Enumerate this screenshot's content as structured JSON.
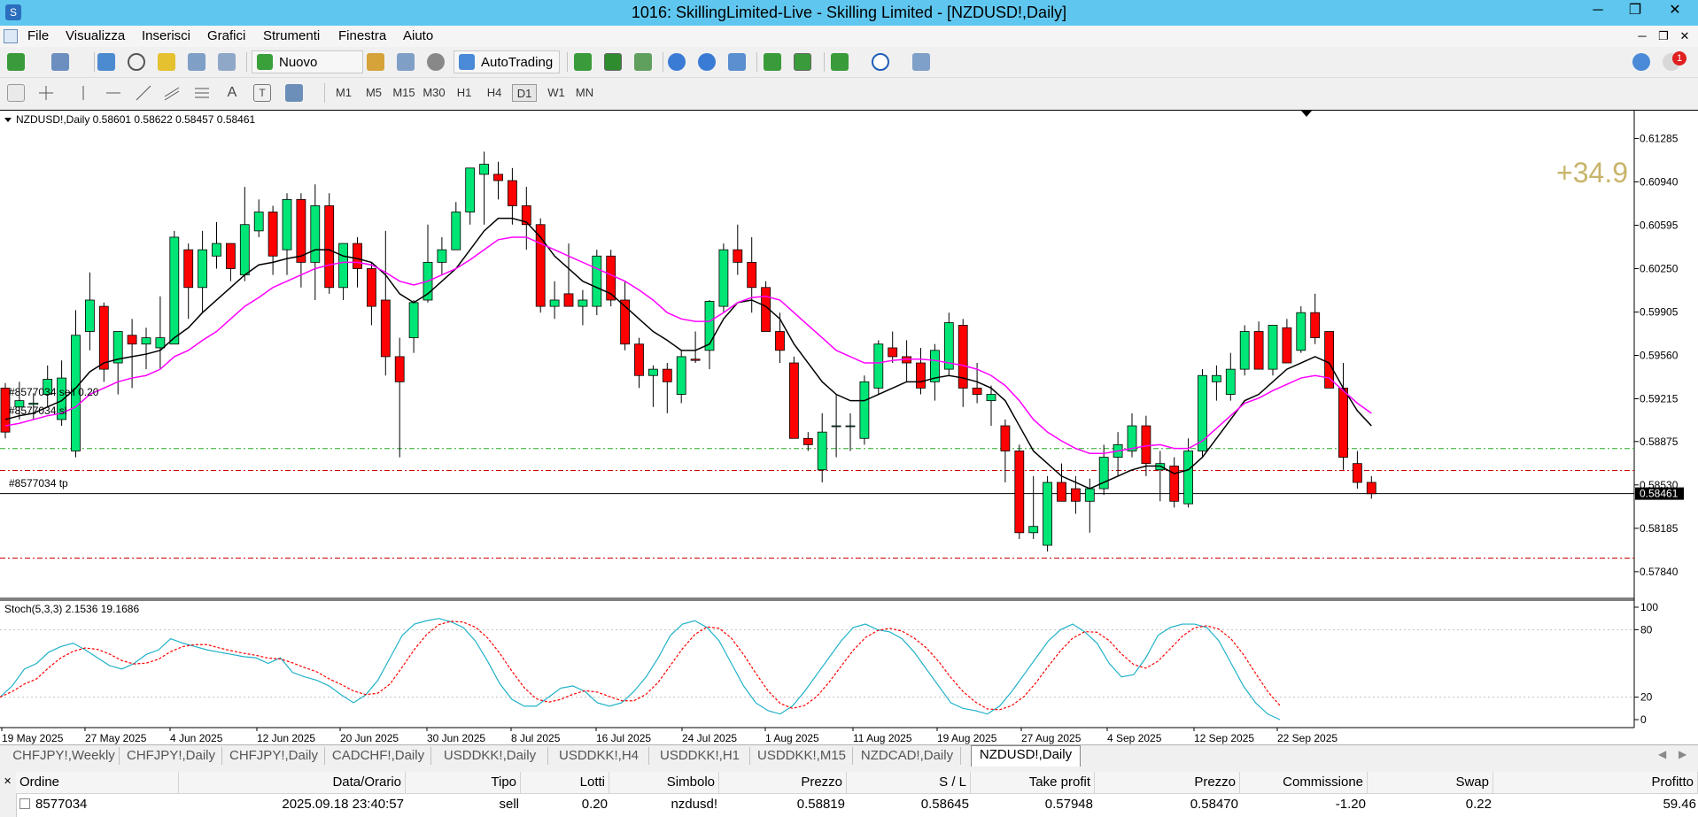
{
  "window": {
    "title": "1016: SkillingLimited-Live - Skilling Limited - [NZDUSD!,Daily]",
    "minimize": "─",
    "restore": "❐",
    "close": "✕"
  },
  "menu": [
    "File",
    "Visualizza",
    "Inserisci",
    "Grafici",
    "Strumenti",
    "Finestra",
    "Aiuto"
  ],
  "toolbar": {
    "new_order": "Nuovo ordine",
    "autotrading": "AutoTrading",
    "notification_count": "1"
  },
  "timeframes": [
    "M1",
    "M5",
    "M15",
    "M30",
    "H1",
    "H4",
    "D1",
    "W1",
    "MN"
  ],
  "active_timeframe": "D1",
  "chart": {
    "header": "NZDUSD!,Daily  0.58601 0.58622 0.58457 0.58461",
    "profit_overlay": "+34.9",
    "current_price": "0.58461",
    "price_ticks": [
      "0.61285",
      "0.60940",
      "0.60595",
      "0.60250",
      "0.59905",
      "0.59560",
      "0.59215",
      "0.58875",
      "0.58530",
      "0.58185",
      "0.57840"
    ],
    "line_labels": {
      "sell": "#8577034 sell 0.20",
      "sl": "#8577034 sl",
      "tp": "#8577034 tp"
    },
    "stoch_header": "Stoch(5,3,3) 2.1536 19.1686",
    "stoch_ticks": [
      "100",
      "80",
      "20",
      "0"
    ],
    "date_ticks": [
      "19 May 2025",
      "27 May 2025",
      "4 Jun 2025",
      "12 Jun 2025",
      "20 Jun 2025",
      "30 Jun 2025",
      "8 Jul 2025",
      "16 Jul 2025",
      "24 Jul 2025",
      "1 Aug 2025",
      "11 Aug 2025",
      "19 Aug 2025",
      "27 Aug 2025",
      "4 Sep 2025",
      "12 Sep 2025",
      "22 Sep 2025"
    ]
  },
  "chart_data": {
    "type": "candlestick",
    "symbol": "NZDUSD!",
    "timeframe": "Daily",
    "ylim": [
      0.5767,
      0.6145
    ],
    "ohlc": [
      [
        0.593,
        0.5934,
        0.589,
        0.5895
      ],
      [
        0.5915,
        0.5935,
        0.5905,
        0.592
      ],
      [
        0.5917,
        0.5926,
        0.5905,
        0.5918
      ],
      [
        0.5925,
        0.5948,
        0.5915,
        0.5937
      ],
      [
        0.5905,
        0.5952,
        0.59,
        0.5938
      ],
      [
        0.588,
        0.5992,
        0.5875,
        0.5972
      ],
      [
        0.5975,
        0.6022,
        0.596,
        0.6
      ],
      [
        0.5995,
        0.5998,
        0.5935,
        0.5945
      ],
      [
        0.595,
        0.5975,
        0.5925,
        0.5975
      ],
      [
        0.5972,
        0.5985,
        0.593,
        0.5965
      ],
      [
        0.5965,
        0.5978,
        0.5945,
        0.597
      ],
      [
        0.5962,
        0.6003,
        0.5945,
        0.597
      ],
      [
        0.5965,
        0.6055,
        0.5965,
        0.605
      ],
      [
        0.604,
        0.6045,
        0.5985,
        0.601
      ],
      [
        0.601,
        0.6055,
        0.599,
        0.604
      ],
      [
        0.6035,
        0.6062,
        0.6025,
        0.6045
      ],
      [
        0.6045,
        0.6045,
        0.6015,
        0.6025
      ],
      [
        0.602,
        0.609,
        0.6015,
        0.606
      ],
      [
        0.6055,
        0.608,
        0.605,
        0.607
      ],
      [
        0.607,
        0.6075,
        0.602,
        0.6035
      ],
      [
        0.604,
        0.6085,
        0.602,
        0.608
      ],
      [
        0.608,
        0.6085,
        0.601,
        0.603
      ],
      [
        0.603,
        0.6092,
        0.6,
        0.6075
      ],
      [
        0.6075,
        0.6085,
        0.6005,
        0.601
      ],
      [
        0.601,
        0.6045,
        0.6,
        0.6045
      ],
      [
        0.6045,
        0.605,
        0.601,
        0.6025
      ],
      [
        0.6025,
        0.603,
        0.598,
        0.5995
      ],
      [
        0.6,
        0.6055,
        0.594,
        0.5955
      ],
      [
        0.5955,
        0.597,
        0.5875,
        0.5935
      ],
      [
        0.597,
        0.6,
        0.5958,
        0.5998
      ],
      [
        0.6,
        0.606,
        0.5998,
        0.603
      ],
      [
        0.603,
        0.605,
        0.602,
        0.604
      ],
      [
        0.604,
        0.6078,
        0.604,
        0.607
      ],
      [
        0.607,
        0.6088,
        0.606,
        0.6105
      ],
      [
        0.61,
        0.6118,
        0.606,
        0.6108
      ],
      [
        0.61,
        0.611,
        0.608,
        0.6095
      ],
      [
        0.6095,
        0.6105,
        0.606,
        0.6075
      ],
      [
        0.6075,
        0.609,
        0.604,
        0.606
      ],
      [
        0.606,
        0.6065,
        0.599,
        0.5995
      ],
      [
        0.5995,
        0.6015,
        0.5985,
        0.6
      ],
      [
        0.6005,
        0.6045,
        0.5995,
        0.5995
      ],
      [
        0.5995,
        0.6008,
        0.598,
        0.6
      ],
      [
        0.5995,
        0.604,
        0.5988,
        0.6035
      ],
      [
        0.6035,
        0.604,
        0.5995,
        0.6
      ],
      [
        0.6,
        0.6015,
        0.596,
        0.5965
      ],
      [
        0.5965,
        0.597,
        0.593,
        0.594
      ],
      [
        0.594,
        0.5948,
        0.5915,
        0.5945
      ],
      [
        0.5945,
        0.595,
        0.591,
        0.5935
      ],
      [
        0.5925,
        0.596,
        0.5918,
        0.5955
      ],
      [
        0.5953,
        0.5975,
        0.595,
        0.5952
      ],
      [
        0.596,
        0.6,
        0.5945,
        0.5999
      ],
      [
        0.5995,
        0.6045,
        0.599,
        0.604
      ],
      [
        0.604,
        0.606,
        0.602,
        0.603
      ],
      [
        0.603,
        0.605,
        0.599,
        0.601
      ],
      [
        0.601,
        0.6015,
        0.598,
        0.5975
      ],
      [
        0.5975,
        0.599,
        0.595,
        0.596
      ],
      [
        0.595,
        0.5955,
        0.589,
        0.589
      ],
      [
        0.589,
        0.5895,
        0.588,
        0.5885
      ],
      [
        0.5865,
        0.591,
        0.5855,
        0.5895
      ],
      [
        0.59,
        0.5925,
        0.5875,
        0.59
      ],
      [
        0.59,
        0.591,
        0.588,
        0.59
      ],
      [
        0.589,
        0.594,
        0.5885,
        0.5935
      ],
      [
        0.593,
        0.5968,
        0.5925,
        0.5965
      ],
      [
        0.5962,
        0.5975,
        0.595,
        0.5955
      ],
      [
        0.5955,
        0.5968,
        0.5935,
        0.595
      ],
      [
        0.595,
        0.5962,
        0.5925,
        0.593
      ],
      [
        0.5935,
        0.5965,
        0.592,
        0.596
      ],
      [
        0.5945,
        0.599,
        0.594,
        0.5982
      ],
      [
        0.598,
        0.5985,
        0.5915,
        0.593
      ],
      [
        0.593,
        0.595,
        0.5918,
        0.5925
      ],
      [
        0.592,
        0.5932,
        0.59,
        0.5925
      ],
      [
        0.59,
        0.5905,
        0.5855,
        0.588
      ],
      [
        0.588,
        0.5885,
        0.581,
        0.5815
      ],
      [
        0.5815,
        0.586,
        0.581,
        0.582
      ],
      [
        0.5805,
        0.586,
        0.58,
        0.5855
      ],
      [
        0.5855,
        0.587,
        0.584,
        0.584
      ],
      [
        0.585,
        0.586,
        0.583,
        0.584
      ],
      [
        0.584,
        0.5858,
        0.5815,
        0.585
      ],
      [
        0.585,
        0.5885,
        0.5845,
        0.5875
      ],
      [
        0.5875,
        0.5895,
        0.586,
        0.5885
      ],
      [
        0.588,
        0.591,
        0.5875,
        0.59
      ],
      [
        0.59,
        0.5908,
        0.586,
        0.587
      ],
      [
        0.5865,
        0.588,
        0.584,
        0.587
      ],
      [
        0.5868,
        0.5875,
        0.5835,
        0.584
      ],
      [
        0.5838,
        0.589,
        0.5835,
        0.588
      ],
      [
        0.588,
        0.5945,
        0.5875,
        0.594
      ],
      [
        0.5935,
        0.5948,
        0.592,
        0.594
      ],
      [
        0.5925,
        0.5958,
        0.592,
        0.5945
      ],
      [
        0.5945,
        0.598,
        0.594,
        0.5975
      ],
      [
        0.5975,
        0.5983,
        0.5945,
        0.5945
      ],
      [
        0.5945,
        0.598,
        0.594,
        0.598
      ],
      [
        0.5978,
        0.5985,
        0.595,
        0.595
      ],
      [
        0.596,
        0.5995,
        0.5958,
        0.599
      ],
      [
        0.599,
        0.6005,
        0.5965,
        0.597
      ],
      [
        0.5975,
        0.5975,
        0.593,
        0.593
      ],
      [
        0.593,
        0.595,
        0.5865,
        0.5875
      ],
      [
        0.587,
        0.588,
        0.585,
        0.5855
      ],
      [
        0.5855,
        0.586,
        0.5842,
        0.5846
      ]
    ],
    "series": [
      {
        "color": "#000000",
        "values": [
          0.5905,
          0.5908,
          0.591,
          0.5915,
          0.592,
          0.593,
          0.5943,
          0.595,
          0.5953,
          0.5955,
          0.5957,
          0.596,
          0.597,
          0.5978,
          0.599,
          0.6,
          0.601,
          0.602,
          0.6028,
          0.603,
          0.6033,
          0.6035,
          0.604,
          0.604,
          0.6035,
          0.6033,
          0.603,
          0.602,
          0.6005,
          0.5998,
          0.6005,
          0.6015,
          0.6025,
          0.604,
          0.6055,
          0.6065,
          0.6065,
          0.6062,
          0.605,
          0.6035,
          0.6025,
          0.6015,
          0.601,
          0.6005,
          0.5995,
          0.5985,
          0.5975,
          0.5968,
          0.596,
          0.596,
          0.5965,
          0.5985,
          0.5998,
          0.6,
          0.5995,
          0.5985,
          0.5965,
          0.595,
          0.5935,
          0.5925,
          0.592,
          0.592,
          0.5925,
          0.593,
          0.5935,
          0.5935,
          0.5938,
          0.594,
          0.5938,
          0.5935,
          0.593,
          0.592,
          0.59,
          0.588,
          0.587,
          0.586,
          0.5855,
          0.585,
          0.5855,
          0.586,
          0.5865,
          0.5868,
          0.5868,
          0.5862,
          0.5865,
          0.5875,
          0.589,
          0.5905,
          0.592,
          0.5925,
          0.5935,
          0.5945,
          0.595,
          0.5955,
          0.595,
          0.593,
          0.5912,
          0.59
        ]
      },
      {
        "color": "#ff00ff",
        "values": [
          0.59,
          0.5902,
          0.5905,
          0.5908,
          0.591,
          0.5915,
          0.5925,
          0.593,
          0.5935,
          0.5938,
          0.594,
          0.5945,
          0.5955,
          0.596,
          0.5968,
          0.5975,
          0.5985,
          0.5995,
          0.6002,
          0.601,
          0.6015,
          0.602,
          0.6025,
          0.6028,
          0.603,
          0.603,
          0.6028,
          0.6022,
          0.6015,
          0.6012,
          0.6015,
          0.602,
          0.6025,
          0.6032,
          0.604,
          0.6048,
          0.605,
          0.605,
          0.6045,
          0.604,
          0.6035,
          0.603,
          0.6025,
          0.602,
          0.6015,
          0.6008,
          0.6,
          0.599,
          0.5985,
          0.5983,
          0.5983,
          0.599,
          0.5998,
          0.6002,
          0.6003,
          0.6,
          0.599,
          0.598,
          0.597,
          0.596,
          0.5955,
          0.595,
          0.595,
          0.5952,
          0.5953,
          0.5953,
          0.5952,
          0.595,
          0.5948,
          0.5945,
          0.594,
          0.5932,
          0.592,
          0.5905,
          0.5895,
          0.5888,
          0.5882,
          0.5878,
          0.5878,
          0.588,
          0.5882,
          0.5884,
          0.5885,
          0.5882,
          0.5882,
          0.5888,
          0.5898,
          0.5908,
          0.5918,
          0.5922,
          0.5928,
          0.5933,
          0.5938,
          0.594,
          0.5938,
          0.5928,
          0.5918,
          0.591
        ]
      }
    ],
    "levels": {
      "current": {
        "value": 0.58461,
        "color": "#000000"
      },
      "sell_entry": {
        "value": 0.58819,
        "color": "#22aa22"
      },
      "stop_loss": {
        "value": 0.58645,
        "color": "#cc0000"
      },
      "take_profit": {
        "value": 0.57948,
        "color": "#cc0000"
      }
    },
    "stoch": {
      "ylim": [
        0,
        100
      ],
      "levels": [
        80,
        20
      ],
      "k_color": "#20b2c8",
      "d_color": "#ff0000",
      "k": [
        20,
        30,
        45,
        50,
        60,
        65,
        68,
        62,
        55,
        48,
        45,
        50,
        58,
        62,
        72,
        68,
        65,
        62,
        60,
        58,
        56,
        55,
        50,
        55,
        42,
        38,
        35,
        30,
        22,
        15,
        22,
        35,
        55,
        75,
        85,
        88,
        90,
        87,
        82,
        70,
        52,
        32,
        18,
        12,
        12,
        20,
        28,
        30,
        25,
        15,
        12,
        15,
        25,
        38,
        55,
        75,
        85,
        88,
        82,
        70,
        50,
        30,
        15,
        8,
        5,
        12,
        25,
        40,
        55,
        70,
        82,
        85,
        80,
        78,
        72,
        60,
        45,
        30,
        15,
        10,
        8,
        5,
        12,
        25,
        40,
        55,
        70,
        80,
        85,
        78,
        68,
        50,
        38,
        40,
        55,
        75,
        82,
        85,
        85,
        82,
        70,
        50,
        30,
        15,
        5,
        0
      ]
    }
  },
  "tabs": [
    "CHFJPY!,Weekly",
    "CHFJPY!,Daily",
    "CHFJPY!,Daily",
    "CADCHF!,Daily",
    "USDDKK!,Daily",
    "USDDKK!,H4",
    "USDDKK!,H1",
    "USDDKK!,M15",
    "NZDCAD!,Daily",
    "NZDUSD!,Daily"
  ],
  "active_tab": 9,
  "orders": {
    "headers": [
      "Ordine",
      "Data/Orario",
      "Tipo",
      "Lotti",
      "Simbolo",
      "Prezzo",
      "S / L",
      "Take profit",
      "Prezzo",
      "Commissione",
      "Swap",
      "Profitto"
    ],
    "rows": [
      [
        "8577034",
        "2025.09.18 23:40:57",
        "sell",
        "0.20",
        "nzdusd!",
        "0.58819",
        "0.58645",
        "0.57948",
        "0.58470",
        "-1.20",
        "0.22",
        "59.46"
      ]
    ]
  }
}
